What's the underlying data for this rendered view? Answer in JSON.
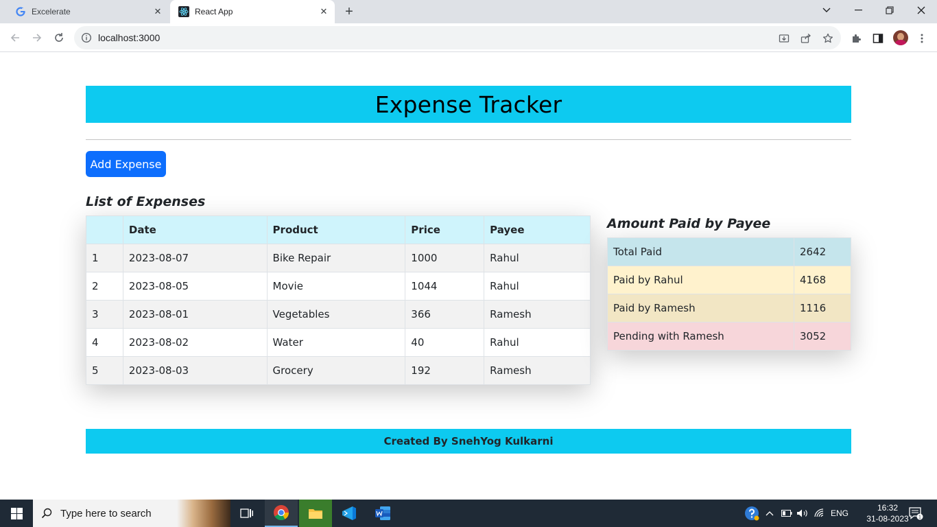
{
  "browser": {
    "tabs": [
      {
        "title": "Excelerate",
        "active": false
      },
      {
        "title": "React App",
        "active": true
      }
    ],
    "url": "localhost:3000"
  },
  "page": {
    "header_title": "Expense Tracker",
    "add_button_label": "Add Expense",
    "expenses_title": "List of Expenses",
    "expenses_table": {
      "headers": [
        "",
        "Date",
        "Product",
        "Price",
        "Payee"
      ],
      "rows": [
        [
          "1",
          "2023-08-07",
          "Bike Repair",
          "1000",
          "Rahul"
        ],
        [
          "2",
          "2023-08-05",
          "Movie",
          "1044",
          "Rahul"
        ],
        [
          "3",
          "2023-08-01",
          "Vegetables",
          "366",
          "Ramesh"
        ],
        [
          "4",
          "2023-08-02",
          "Water",
          "40",
          "Rahul"
        ],
        [
          "5",
          "2023-08-03",
          "Grocery",
          "192",
          "Ramesh"
        ]
      ]
    },
    "payee_title": "Amount Paid by Payee",
    "payee_table": [
      {
        "label": "Total Paid",
        "value": "2642",
        "color": "#c5e5ec"
      },
      {
        "label": "Paid by Rahul",
        "value": "4168",
        "color": "#fff2cd"
      },
      {
        "label": "Paid by Ramesh",
        "value": "1116",
        "color": "#f2e6c4"
      },
      {
        "label": "Pending with Ramesh",
        "value": "3052",
        "color": "#f7d6da"
      }
    ],
    "footer_text": "Created By SnehYog Kulkarni"
  },
  "taskbar": {
    "search_placeholder": "Type here to search",
    "language": "ENG",
    "time": "16:32",
    "date": "31-08-2023",
    "notification_count": "1"
  },
  "colors": {
    "header_bg": "#0dcaf0",
    "primary_button": "#0d6efd",
    "table_header_bg": "#cff4fc"
  }
}
